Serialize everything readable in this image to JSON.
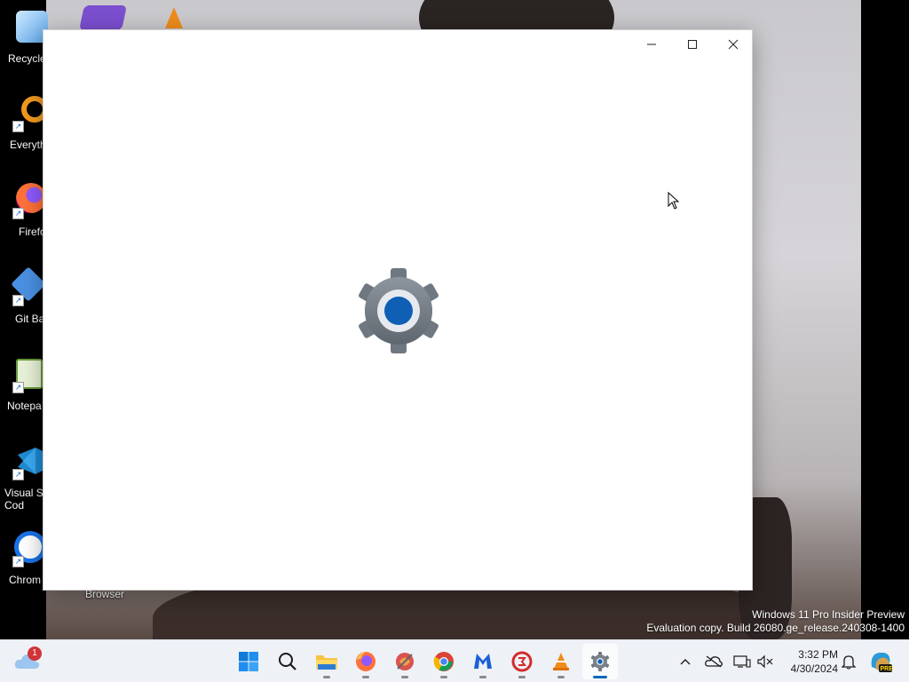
{
  "desktop": {
    "icons": [
      {
        "label": "Recycle",
        "icon": "recycle-bin-icon"
      },
      {
        "label": "Everyth",
        "icon": "everything-search-icon"
      },
      {
        "label": "Firefo",
        "icon": "firefox-icon"
      },
      {
        "label": "Git Ba",
        "icon": "git-bash-icon"
      },
      {
        "label": "Notepa",
        "icon": "notepad-plus-plus-icon"
      },
      {
        "label": "Visual St\nCod",
        "icon": "vscode-icon"
      },
      {
        "label": "Chrom",
        "icon": "chrome-icon"
      }
    ],
    "background_label": "Browser"
  },
  "window": {
    "app": "Settings",
    "splash_icon": "settings-gear-icon",
    "controls": {
      "minimize": "minimize-icon",
      "maximize": "maximize-icon",
      "close": "close-icon"
    }
  },
  "watermark": {
    "line1": "Windows 11 Pro Insider Preview",
    "line2": "Evaluation copy. Build 26080.ge_release.240308-1400"
  },
  "taskbar": {
    "weather_badge": "1",
    "apps": [
      {
        "name": "Start",
        "icon": "windows-start-icon"
      },
      {
        "name": "Search",
        "icon": "search-icon"
      },
      {
        "name": "File Explorer",
        "icon": "folder-icon"
      },
      {
        "name": "Firefox",
        "icon": "firefox-icon"
      },
      {
        "name": "CCleaner",
        "icon": "ccleaner-icon"
      },
      {
        "name": "Chrome",
        "icon": "chrome-icon"
      },
      {
        "name": "Malwarebytes",
        "icon": "malwarebytes-icon"
      },
      {
        "name": "Recovery",
        "icon": "recovery-icon"
      },
      {
        "name": "VLC",
        "icon": "vlc-icon"
      },
      {
        "name": "Settings",
        "icon": "settings-gear-icon"
      }
    ],
    "time": "3:32 PM",
    "date": "4/30/2024",
    "colors": {
      "accent": "#0067c0",
      "taskbar_bg": "#eef1f6"
    }
  }
}
